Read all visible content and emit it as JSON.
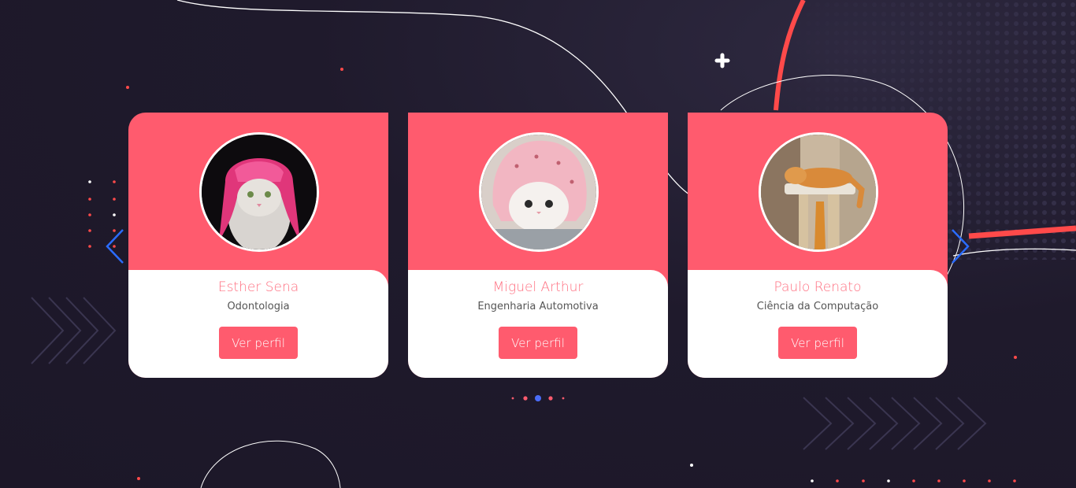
{
  "carousel": {
    "cards": [
      {
        "name": "Esther Sena",
        "course": "Odontologia",
        "button_label": "Ver perfil",
        "photo": "cat with pink wig"
      },
      {
        "name": "Miguel Arthur",
        "course": "Engenharia Automotiva",
        "button_label": "Ver perfil",
        "photo": "kitten in pink hat"
      },
      {
        "name": "Paulo Renato",
        "course": "Ciência da Computação",
        "button_label": "Ver perfil",
        "photo": "orange cat sleeping on scratching post"
      }
    ],
    "active_index": 2,
    "page_count": 5,
    "prev_icon": "chevron-left-icon",
    "next_icon": "chevron-right-icon"
  },
  "colors": {
    "background": "#1f1a2c",
    "accent": "#ff5b6e",
    "arrow": "#2b6cff",
    "active_dot": "#4a6cf7"
  }
}
